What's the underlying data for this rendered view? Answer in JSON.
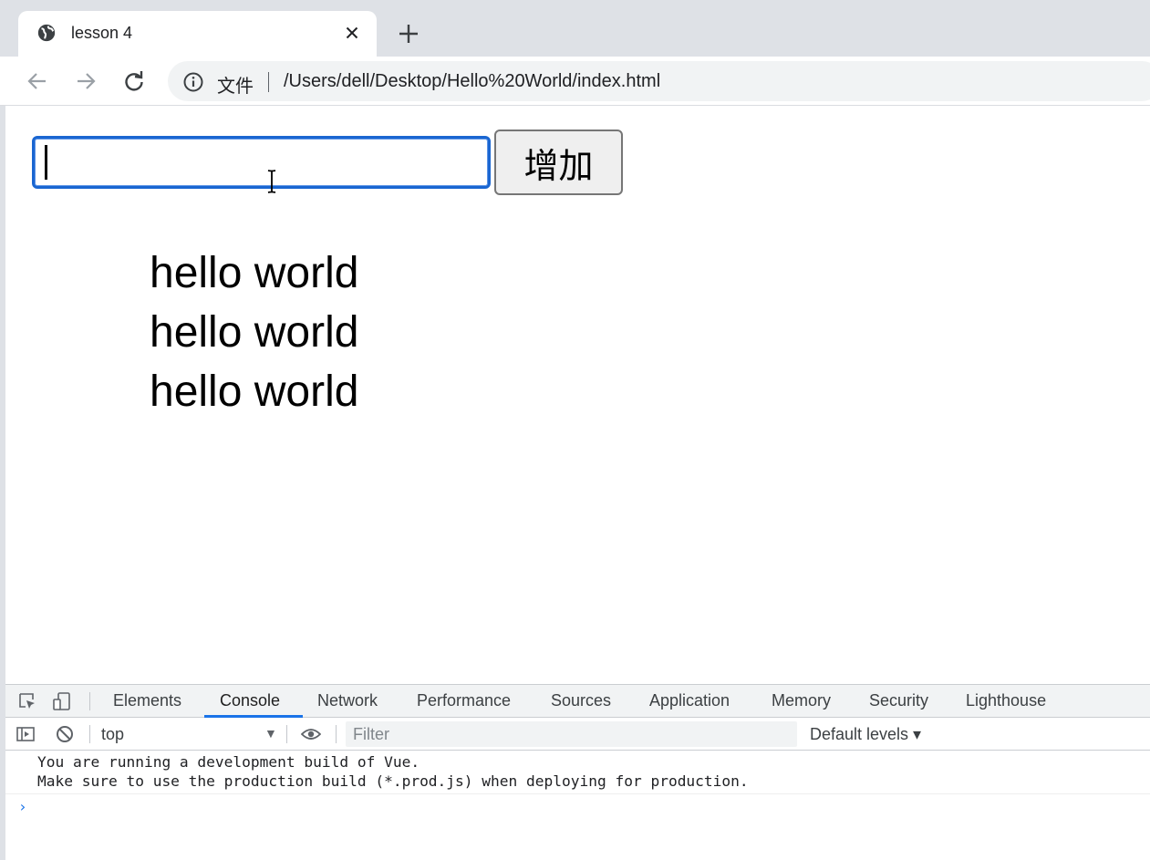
{
  "browser": {
    "tab": {
      "title": "lesson 4"
    },
    "address_bar": {
      "site_label": "文件",
      "url": "/Users/dell/Desktop/Hello%20World/index.html"
    }
  },
  "app": {
    "input": {
      "value": "",
      "placeholder": ""
    },
    "add_button_label": "增加",
    "list_items": [
      "hello world",
      "hello world",
      "hello world"
    ]
  },
  "devtools": {
    "tabs": [
      "Elements",
      "Console",
      "Network",
      "Performance",
      "Sources",
      "Application",
      "Memory",
      "Security",
      "Lighthouse"
    ],
    "active_tab": "Console",
    "context": "top",
    "filter_placeholder": "Filter",
    "levels": "Default levels ▾",
    "console_messages": [
      "You are running a development build of Vue.",
      "Make sure to use the production build (*.prod.js) when deploying for production."
    ],
    "prompt_symbol": "›"
  },
  "colors": {
    "accent": "#1a73e8",
    "input_focus": "#1a66d1",
    "chrome_bg": "#dee1e6"
  }
}
